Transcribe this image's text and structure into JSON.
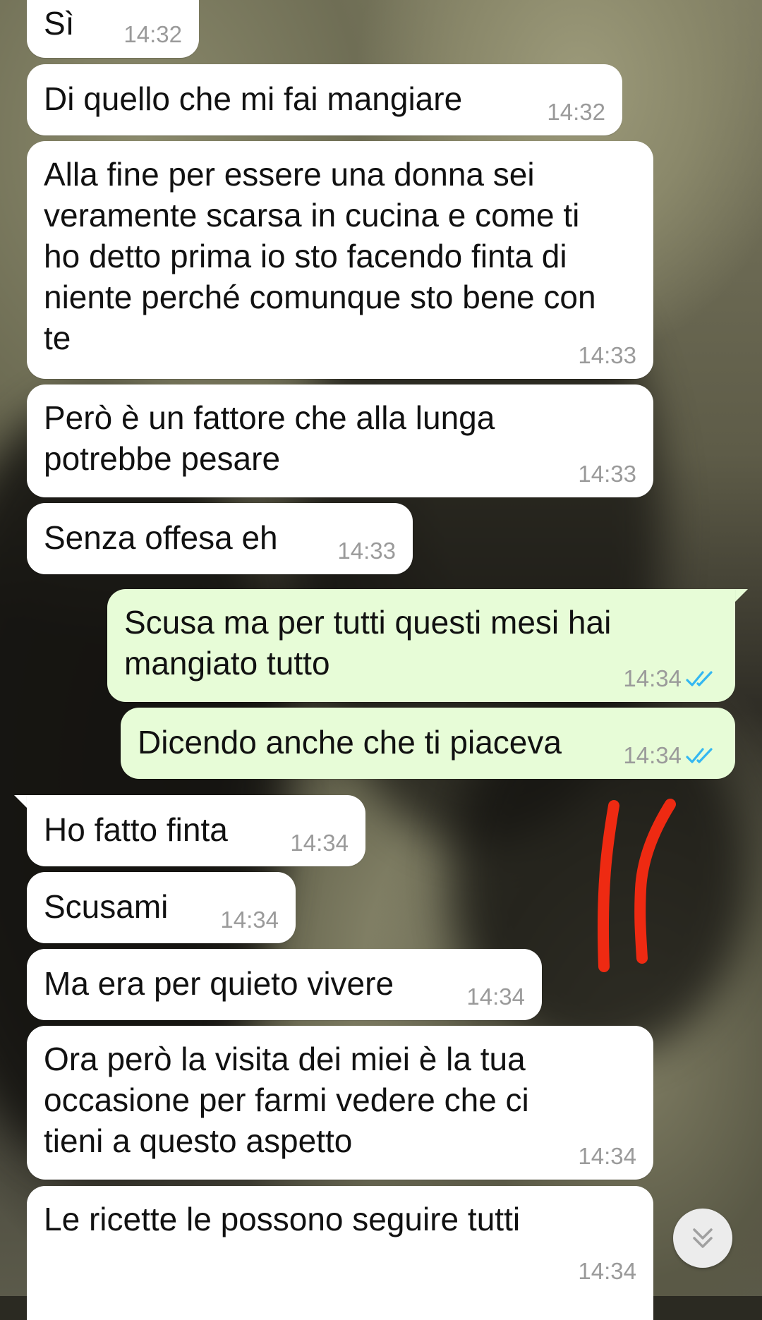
{
  "messages": [
    {
      "side": "in",
      "text": "Sì",
      "time": "14:32"
    },
    {
      "side": "in",
      "text": "Di quello che mi fai mangiare",
      "time": "14:32"
    },
    {
      "side": "in",
      "text": "Alla fine per essere una donna sei veramente scarsa in cucina e come ti ho detto prima io sto facendo finta di niente perché comunque sto bene con te",
      "time": "14:33"
    },
    {
      "side": "in",
      "text": "Però è un fattore che alla lunga potrebbe pesare",
      "time": "14:33"
    },
    {
      "side": "in",
      "text": "Senza offesa eh",
      "time": "14:33"
    },
    {
      "side": "out",
      "text": "Scusa ma per tutti questi mesi hai mangiato tutto",
      "time": "14:34",
      "status": "read"
    },
    {
      "side": "out",
      "text": "Dicendo anche che ti piaceva",
      "time": "14:34",
      "status": "read"
    },
    {
      "side": "in",
      "text": "Ho fatto finta",
      "time": "14:34"
    },
    {
      "side": "in",
      "text": "Scusami",
      "time": "14:34"
    },
    {
      "side": "in",
      "text": "Ma era per quieto vivere",
      "time": "14:34"
    },
    {
      "side": "in",
      "text": "Ora però la visita dei miei è la tua occasione per farmi vedere che ci tieni a questo aspetto",
      "time": "14:34"
    },
    {
      "side": "in",
      "text": "Le ricette le possono seguire tutti",
      "time": "14:34"
    }
  ],
  "colors": {
    "incoming_bubble": "#ffffff",
    "outgoing_bubble": "#e7fcd7",
    "read_ticks": "#34b7f1",
    "annotation": "#ee2a12"
  },
  "icons": {
    "read_receipt": "double-check-icon",
    "scroll_down": "double-chevron-down-icon"
  }
}
